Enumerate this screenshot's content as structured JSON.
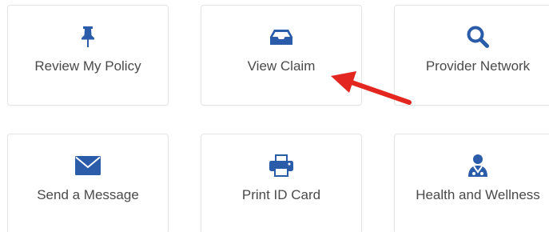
{
  "colors": {
    "icon": "#2a5caa",
    "label": "#4a4a4a",
    "arrow": "#e32620",
    "tile_border": "#e3e5e8"
  },
  "tiles": [
    {
      "label": "Review My Policy",
      "icon": "pushpin-icon"
    },
    {
      "label": "View Claim",
      "icon": "inbox-icon"
    },
    {
      "label": "Provider Network",
      "icon": "search-icon"
    },
    {
      "label": "Send a Message",
      "icon": "envelope-icon"
    },
    {
      "label": "Print ID Card",
      "icon": "printer-icon"
    },
    {
      "label": "Health and Wellness",
      "icon": "doctor-icon"
    }
  ]
}
